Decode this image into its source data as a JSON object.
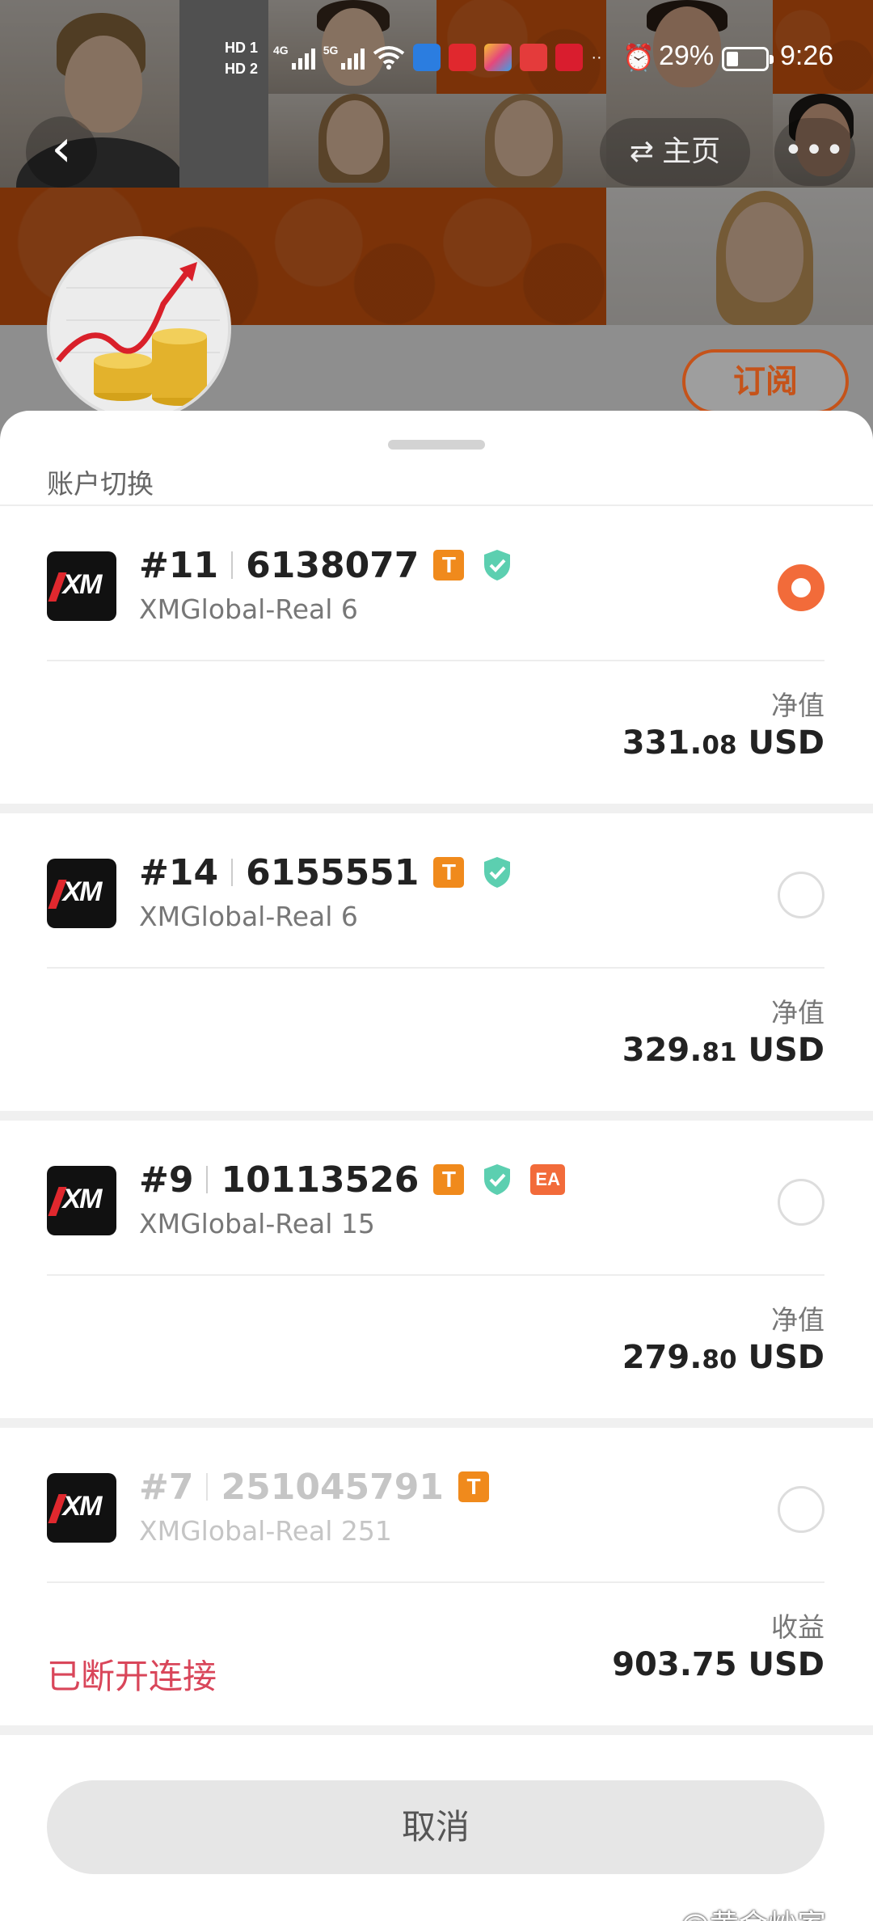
{
  "status_bar": {
    "hd1": "HD 1",
    "hd2": "HD 2",
    "net1": "4G",
    "net2": "5G",
    "battery_pct": "29%",
    "battery_level": 0.29,
    "time": "9:26"
  },
  "header": {
    "home_label": "主页",
    "subscribe_label": "订阅"
  },
  "sheet": {
    "title": "账户切换",
    "cancel_label": "取消"
  },
  "accounts": [
    {
      "index": "#11",
      "number": "6138077",
      "server": "XMGlobal-Real 6",
      "badges": [
        "T",
        "shield"
      ],
      "selected": true,
      "metric_label": "净值",
      "value_int": "331.",
      "value_dec": "08",
      "currency": "USD"
    },
    {
      "index": "#14",
      "number": "6155551",
      "server": "XMGlobal-Real 6",
      "badges": [
        "T",
        "shield"
      ],
      "selected": false,
      "metric_label": "净值",
      "value_int": "329.",
      "value_dec": "81",
      "currency": "USD"
    },
    {
      "index": "#9",
      "number": "10113526",
      "server": "XMGlobal-Real 15",
      "badges": [
        "T",
        "shield",
        "EA"
      ],
      "ea_label": "EA",
      "selected": false,
      "metric_label": "净值",
      "value_int": "279.",
      "value_dec": "80",
      "currency": "USD"
    },
    {
      "index": "#7",
      "number": "251045791",
      "server": "XMGlobal-Real 251",
      "badges": [
        "T"
      ],
      "selected": false,
      "metric_label": "收益",
      "value_full": "903.75 USD",
      "status": "已断开连接"
    }
  ],
  "badge_t": "T",
  "broker_logo": "XM",
  "watermark": "@黄金炒家",
  "colors": {
    "accent": "#f26b3a",
    "badge_t": "#f08a1c",
    "shield": "#5ccfb0",
    "disconnected": "#d9465a"
  }
}
